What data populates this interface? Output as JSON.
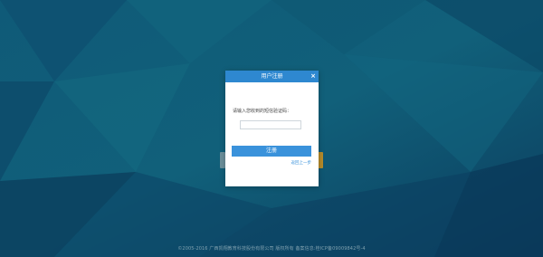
{
  "modal": {
    "title": "用户注册",
    "close_icon": "×",
    "prompt": "请输入您收到的短信验证码：",
    "code_input_value": "",
    "code_input_placeholder": "",
    "submit_label": "注册",
    "back_link": "返回上一步"
  },
  "footer": {
    "copyright": "©2005-2016 广西凯翔教育科技股份有限公司 版权所有 备案信息:桂ICP备09009842号-4"
  },
  "colors": {
    "background_dark": "#0d3f5c",
    "background_mid": "#14617a",
    "header_blue": "#2e88d0",
    "button_blue": "#3a92db"
  }
}
